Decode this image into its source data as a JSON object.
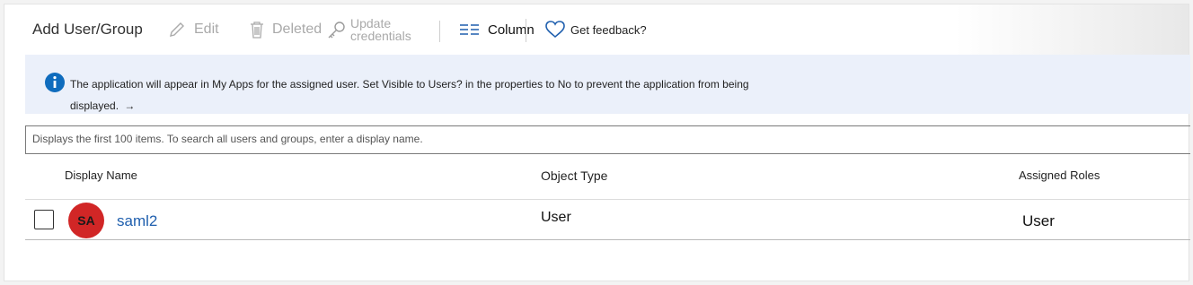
{
  "toolbar": {
    "add_label": "Add User/Group",
    "edit_label": "Edit",
    "deleted_label": "Deleted",
    "update_line1": "Update",
    "update_line2": "credentials",
    "column_label": "Column",
    "feedback_label": "Get feedback?"
  },
  "info": {
    "message_line1": "The application will appear in My Apps for the assigned user. Set Visible to Users? in the properties to No to prevent the application from being",
    "message_line2": "displayed.",
    "arrow": "→",
    "accent": "#0f6cbd"
  },
  "search": {
    "placeholder": "Displays the first 100 items. To search all users and groups, enter a display name."
  },
  "table": {
    "columns": [
      "Display Name",
      "Object Type",
      "Assigned Roles"
    ],
    "rows": [
      {
        "initials": "SA",
        "display_name": "saml2",
        "object_type": "User",
        "assigned_role": "User"
      }
    ]
  },
  "colors": {
    "avatar_bg": "#d12626",
    "link": "#1f5fae",
    "info_bg": "#ebf0fa"
  }
}
